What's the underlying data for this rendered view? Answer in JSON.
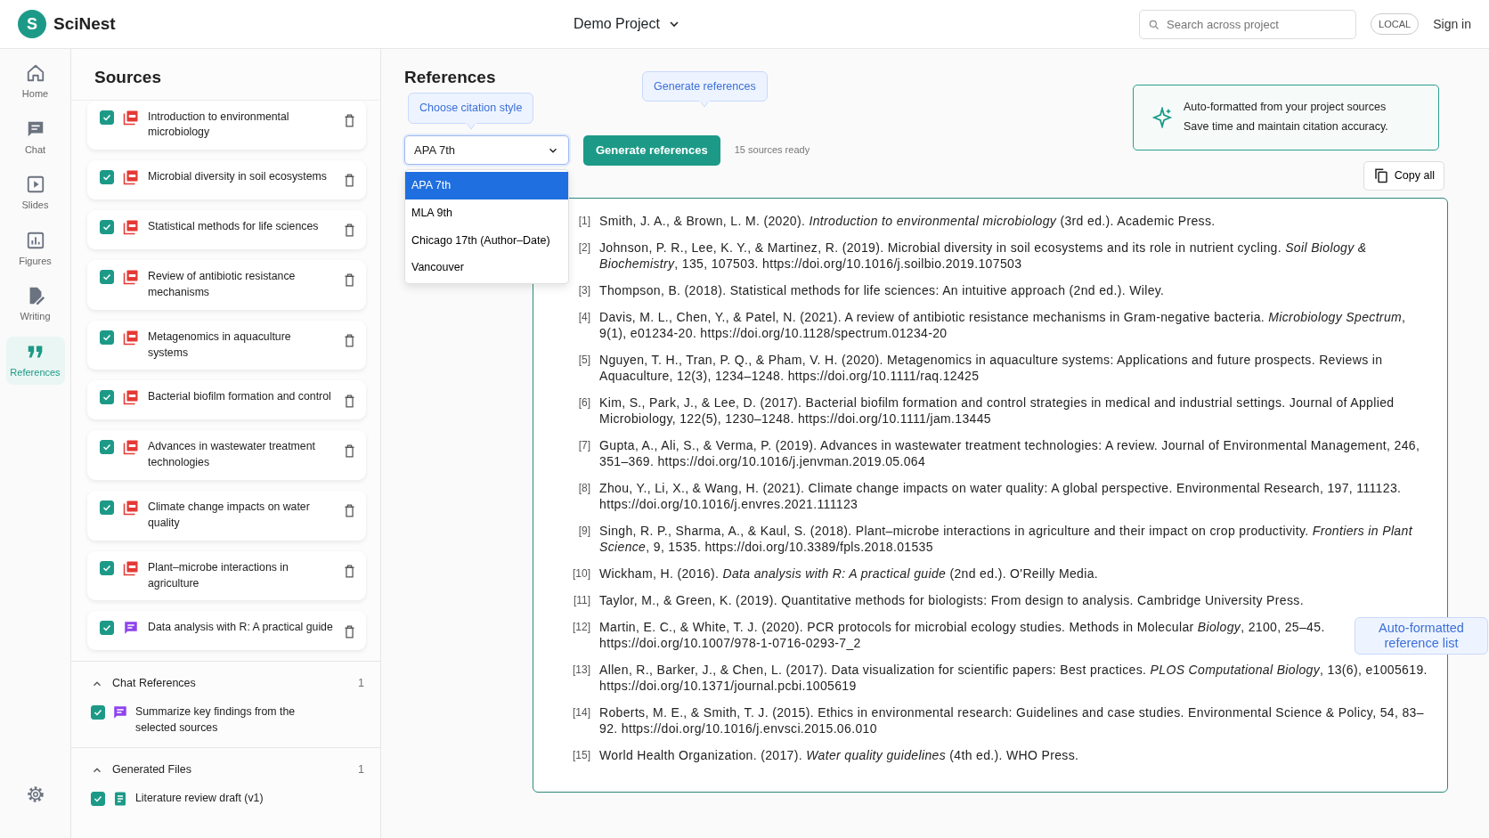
{
  "topbar": {
    "logo_letter": "S",
    "app_name": "SciNest",
    "project": "Demo Project",
    "search": {
      "placeholder": "Search across project"
    },
    "mode_badge": "LOCAL",
    "sign_in": "Sign in"
  },
  "nav": [
    {
      "label": "Home",
      "selected": false
    },
    {
      "label": "Chat",
      "selected": false
    },
    {
      "label": "Slides",
      "selected": false
    },
    {
      "label": "Figures",
      "selected": false
    },
    {
      "label": "Writing",
      "selected": false
    },
    {
      "label": "References",
      "selected": true
    }
  ],
  "sources": {
    "title": "Sources",
    "items": [
      {
        "kind": "pdf",
        "title": "Introduction to environmental microbiology",
        "checked": true
      },
      {
        "kind": "pdf",
        "title": "Microbial diversity in soil ecosystems",
        "checked": true
      },
      {
        "kind": "pdf",
        "title": "Statistical methods for life sciences",
        "checked": true
      },
      {
        "kind": "pdf",
        "title": "Review of antibiotic resistance mechanisms",
        "checked": true
      },
      {
        "kind": "pdf",
        "title": "Metagenomics in aquaculture systems",
        "checked": true
      },
      {
        "kind": "pdf",
        "title": "Bacterial biofilm formation and control",
        "checked": true
      },
      {
        "kind": "pdf",
        "title": "Advances in wastewater treatment technologies",
        "checked": true
      },
      {
        "kind": "pdf",
        "title": "Climate change impacts on water quality",
        "checked": true
      },
      {
        "kind": "pdf",
        "title": "Plant–microbe interactions in agriculture",
        "checked": true
      },
      {
        "kind": "chat",
        "title": "Data analysis with R: A practical guide",
        "checked": true
      }
    ],
    "sections": [
      {
        "title": "Chat References",
        "count": "1",
        "expanded": true,
        "items": [
          {
            "kind": "chat",
            "title": "Summarize key findings from the selected sources",
            "checked": true
          }
        ]
      },
      {
        "title": "Generated Files",
        "count": "1",
        "expanded": true,
        "items": [
          {
            "kind": "doc",
            "title": "Literature review draft (v1)",
            "checked": true
          }
        ]
      }
    ]
  },
  "references": {
    "title": "References",
    "style_tooltip": "Choose citation style",
    "generate_tooltip": "Generate references",
    "style_select": {
      "value": "APA 7th",
      "expanded": true,
      "options": [
        {
          "label": "APA 7th",
          "selected": true
        },
        {
          "label": "MLA 9th",
          "selected": false
        },
        {
          "label": "Chicago 17th (Author–Date)",
          "selected": false
        },
        {
          "label": "Vancouver",
          "selected": false
        }
      ]
    },
    "generate_button": "Generate references",
    "status": "15 sources ready",
    "info": [
      "Auto-formatted from your project sources",
      "Save time and maintain citation accuracy."
    ],
    "copy_button": "Copy all",
    "callout": "Auto-formatted reference list",
    "list": [
      {
        "number": "[1]",
        "text": "Smith, J. A., & Brown, L. M. (2020). *Introduction to environmental microbiology* (3rd ed.). Academic Press."
      },
      {
        "number": "[2]",
        "text": "Johnson, P. R., Lee, K. Y., & Martinez, R. (2019). Microbial diversity in soil ecosystems and its role in nutrient cycling. *Soil Biology & Biochemistry*, 135, 107503. https://doi.org/10.1016/j.soilbio.2019.107503"
      },
      {
        "number": "[3]",
        "text": "Thompson, B. (2018). Statistical methods for life sciences: An intuitive approach (2nd ed.). Wiley."
      },
      {
        "number": "[4]",
        "text": "Davis, M. L., Chen, Y., & Patel, N. (2021). A review of antibiotic resistance mechanisms in Gram-negative bacteria. *Microbiology Spectrum*, 9(1), e01234-20. https://doi.org/10.1128/spectrum.01234-20"
      },
      {
        "number": "[5]",
        "text": "Nguyen, T. H., Tran, P. Q., & Pham, V. H. (2020). Metagenomics in aquaculture systems: Applications and future prospects. Reviews in Aquaculture, 12(3), 1234–1248. https://doi.org/10.1111/raq.12425"
      },
      {
        "number": "[6]",
        "text": "Kim, S., Park, J., & Lee, D. (2017). Bacterial biofilm formation and control strategies in medical and industrial settings. Journal of Applied Microbiology, 122(5), 1230–1248. https://doi.org/10.1111/jam.13445"
      },
      {
        "number": "[7]",
        "text": "Gupta, A., Ali, S., & Verma, P. (2019). Advances in wastewater treatment technologies: A review. Journal of Environmental Management, 246, 351–369. https://doi.org/10.1016/j.jenvman.2019.05.064"
      },
      {
        "number": "[8]",
        "text": "Zhou, Y., Li, X., & Wang, H. (2021). Climate change impacts on water quality: A global perspective. Environmental Research, 197, 111123. https://doi.org/10.1016/j.envres.2021.111123"
      },
      {
        "number": "[9]",
        "text": "Singh, R. P., Sharma, A., & Kaul, S. (2018). Plant–microbe interactions in agriculture and their impact on crop productivity. *Frontiers in Plant Science*, 9, 1535. https://doi.org/10.3389/fpls.2018.01535"
      },
      {
        "number": "[10]",
        "text": "Wickham, H. (2016). *Data analysis with R: A practical guide* (2nd ed.). O'Reilly Media."
      },
      {
        "number": "[11]",
        "text": "Taylor, M., & Green, K. (2019). Quantitative methods for biologists: From design to analysis. Cambridge University Press."
      },
      {
        "number": "[12]",
        "text": "Martin, E. C., & White, T. J. (2020). PCR protocols for microbial ecology studies. Methods in Molecular *Biology*, 2100, 25–45. https://doi.org/10.1007/978-1-0716-0293-7_2"
      },
      {
        "number": "[13]",
        "text": "Allen, R., Barker, J., & Chen, L. (2017). Data visualization for scientific papers: Best practices. *PLOS Computational Biology*, 13(6), e1005619. https://doi.org/10.1371/journal.pcbi.1005619"
      },
      {
        "number": "[14]",
        "text": "Roberts, M. E., & Smith, T. J. (2015). Ethics in environmental research: Guidelines and case studies. Environmental Science & Policy, 54, 83–92. https://doi.org/10.1016/j.envsci.2015.06.010"
      },
      {
        "number": "[15]",
        "text": "World Health Organization. (2017). *Water quality guidelines* (4th ed.). WHO Press."
      }
    ]
  }
}
